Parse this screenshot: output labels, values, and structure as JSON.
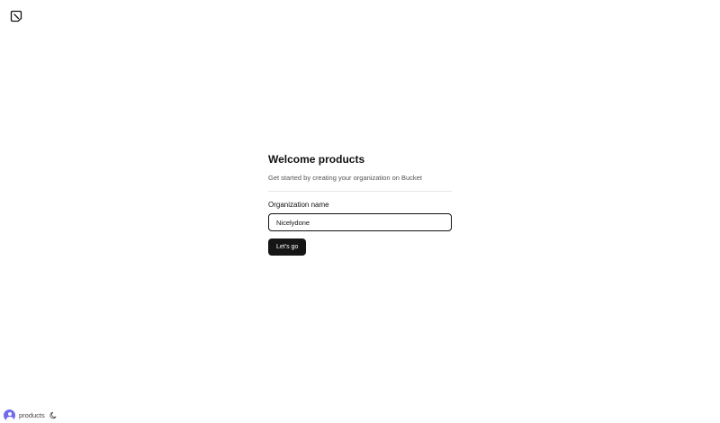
{
  "header": {
    "logo_icon": "bucket-logo-icon"
  },
  "onboarding": {
    "title": "Welcome products",
    "subtitle": "Get started by creating your organization on Bucket",
    "org_label": "Organization name",
    "org_value": "Nicelydone",
    "submit_label": "Let's go"
  },
  "footer": {
    "avatar_icon": "user-avatar-icon",
    "username": "products",
    "theme_icon": "moon-icon"
  },
  "colors": {
    "button_bg": "#151515",
    "avatar_bg": "#6f6cf0",
    "subtitle_text": "#555555"
  }
}
